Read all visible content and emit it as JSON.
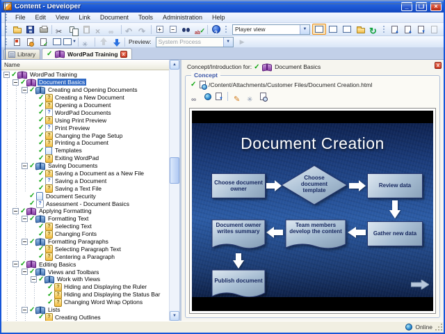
{
  "window": {
    "title": "Content - Developer"
  },
  "menu": {
    "items": [
      "File",
      "Edit",
      "View",
      "Link",
      "Document",
      "Tools",
      "Administration",
      "Help"
    ]
  },
  "toolbar": {
    "player_view_value": "Player view",
    "preview_label": "Preview:",
    "preview_combo_value": "System Process"
  },
  "icons": {
    "toolbar_main": [
      "folder-open",
      "save",
      "print",
      "cut",
      "copy",
      "paste",
      "delete",
      "link",
      "undo",
      "redo",
      "expand-all",
      "collapse-all",
      "find",
      "spelling",
      "help"
    ],
    "view_buttons": [
      "player-view",
      "split-horizontal",
      "split-vertical",
      "open-in-folder",
      "refresh"
    ],
    "document_buttons": [
      "check-out",
      "check-in",
      "get-version",
      "discard"
    ],
    "authoring_buttons": [
      "new-content",
      "preview-content",
      "validate-content",
      "window-view",
      "window-view-menu",
      "broken-links",
      "move-up",
      "move-down",
      "run-preview"
    ],
    "attachment_buttons": [
      "link",
      "publish",
      "export",
      "edit",
      "refresh-links",
      "print-preview"
    ],
    "status": [
      "online-globe"
    ]
  },
  "tabs": [
    {
      "label": "Library"
    },
    {
      "label": "WordPad Training"
    }
  ],
  "left_panel": {
    "column_header": "Name"
  },
  "tree": {
    "items": [
      {
        "label": "WordPad Training",
        "depth": 0,
        "icon": "course",
        "expandable": true
      },
      {
        "label": "Document Basics",
        "depth": 1,
        "icon": "course",
        "expandable": true,
        "selected": true
      },
      {
        "label": "Creating and Opening Documents",
        "depth": 2,
        "icon": "section",
        "expandable": true
      },
      {
        "label": "Creating a New Document",
        "depth": 3,
        "icon": "topic"
      },
      {
        "label": "Opening a Document",
        "depth": 3,
        "icon": "topic"
      },
      {
        "label": "WordPad Documents",
        "depth": 3,
        "icon": "question"
      },
      {
        "label": "Using Print Preview",
        "depth": 3,
        "icon": "topic"
      },
      {
        "label": "Print Preview",
        "depth": 3,
        "icon": "question"
      },
      {
        "label": "Changing the Page Setup",
        "depth": 3,
        "icon": "topic"
      },
      {
        "label": "Printing a Document",
        "depth": 3,
        "icon": "topic"
      },
      {
        "label": "Templates",
        "depth": 3,
        "icon": "page"
      },
      {
        "label": "Exiting WordPad",
        "depth": 3,
        "icon": "topic"
      },
      {
        "label": "Saving Documents",
        "depth": 2,
        "icon": "section",
        "expandable": true
      },
      {
        "label": "Saving a Document as a New File",
        "depth": 3,
        "icon": "topic"
      },
      {
        "label": "Saving a Document",
        "depth": 3,
        "icon": "question"
      },
      {
        "label": "Saving a Text File",
        "depth": 3,
        "icon": "topic"
      },
      {
        "label": "Document Security",
        "depth": 2,
        "icon": "page"
      },
      {
        "label": "Assessment - Document Basics",
        "depth": 2,
        "icon": "question"
      },
      {
        "label": "Applying Formatting",
        "depth": 1,
        "icon": "course",
        "expandable": true
      },
      {
        "label": "Formatting Text",
        "depth": 2,
        "icon": "section",
        "expandable": true
      },
      {
        "label": "Selecting Text",
        "depth": 3,
        "icon": "topic"
      },
      {
        "label": "Changing Fonts",
        "depth": 3,
        "icon": "topic"
      },
      {
        "label": "Formatting Paragraphs",
        "depth": 2,
        "icon": "section",
        "expandable": true
      },
      {
        "label": "Selecting Paragraph Text",
        "depth": 3,
        "icon": "topic"
      },
      {
        "label": "Centering a Paragraph",
        "depth": 3,
        "icon": "topic"
      },
      {
        "label": "Editing Basics",
        "depth": 1,
        "icon": "course",
        "expandable": true
      },
      {
        "label": "Views and Toolbars",
        "depth": 2,
        "icon": "section",
        "expandable": true
      },
      {
        "label": "Work with Views",
        "depth": 3,
        "icon": "section",
        "expandable": true
      },
      {
        "label": "Hiding and Displaying the Ruler",
        "depth": 4,
        "icon": "topic"
      },
      {
        "label": "Hiding and Displaying the Status Bar",
        "depth": 4,
        "icon": "topic"
      },
      {
        "label": "Changing Word Wrap Options",
        "depth": 4,
        "icon": "topic"
      },
      {
        "label": "Lists",
        "depth": 2,
        "icon": "section",
        "expandable": true
      },
      {
        "label": "Creating Outlines",
        "depth": 3,
        "icon": "topic"
      }
    ]
  },
  "right_panel": {
    "header_label": "Concept/Introduction for:",
    "header_target": "Document Basics",
    "group_label": "Concept",
    "attachment_path": "/Content/Attachments/Customer Files/Document Creation.html"
  },
  "diagram": {
    "title": "Document Creation",
    "nodes": {
      "choose_owner": "Choose document owner",
      "choose_template": "Choose document template",
      "review_data": "Review data",
      "gather_data": "Gather new data",
      "team_develop": "Team members develop the content",
      "owner_summary": "Document owner writes summary",
      "publish": "Publish document"
    }
  },
  "status_bar": {
    "online": "Online"
  }
}
